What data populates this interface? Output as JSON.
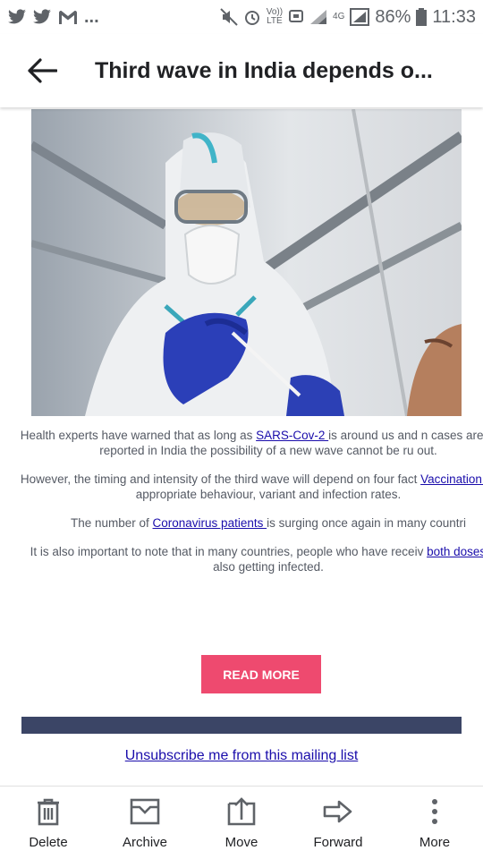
{
  "status_bar": {
    "left_overflow": "...",
    "battery": "86%",
    "time": "11:33",
    "network": "4G",
    "volte_top": "Vo))",
    "volte_bottom": "LTE"
  },
  "app_bar": {
    "title": "Third wave in India depends o..."
  },
  "article": {
    "paragraphs": [
      {
        "before": "Health experts have warned that as long as ",
        "link": "SARS-Cov-2 ",
        "after": "is around us and n cases are being reported in India the possibility of a new wave cannot be ru out."
      },
      {
        "before": "However, the timing and intensity of the third wave will depend on four fact ",
        "link": "Vaccination ",
        "after": "Covid appropriate behaviour, variant and infection rates."
      },
      {
        "before": "The number of ",
        "link": "Coronavirus patients ",
        "after": "is surging once again in many countri"
      },
      {
        "before": "It is also important to note that in many countries, people who have receiv ",
        "link": "both doses ",
        "after": "are also getting infected."
      }
    ],
    "read_more": "READ MORE",
    "unsubscribe": "Unsubscribe me from this mailing list"
  },
  "bottom_bar": {
    "actions": [
      {
        "label": "Delete",
        "icon": "trash-icon"
      },
      {
        "label": "Archive",
        "icon": "archive-icon"
      },
      {
        "label": "Move",
        "icon": "move-icon"
      },
      {
        "label": "Forward",
        "icon": "forward-icon"
      },
      {
        "label": "More",
        "icon": "more-vert-icon"
      }
    ]
  },
  "colors": {
    "read_more_bg": "#ee4a6f",
    "band": "#3b4566",
    "link": "#1a0dab"
  }
}
